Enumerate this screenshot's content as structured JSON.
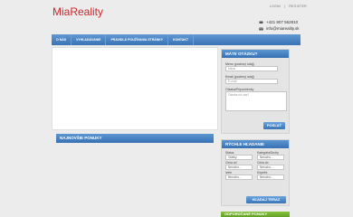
{
  "header": {
    "logo": "MiaReality",
    "links": [
      "LOGIN",
      "REGISTER"
    ],
    "phone": "+421 907 562810",
    "email": "info@miareality.sk"
  },
  "nav": {
    "items": [
      "O NÁS",
      "VYHĽADÁVANIE",
      "PRAVIDLÁ POUŽÍVANIA STRÁNKY",
      "KONTAKT"
    ]
  },
  "sections": {
    "latest_offers": "NAJNOVŠIE PONUKY"
  },
  "contact_form": {
    "title": "MÁTE OTÁZKU?",
    "name_label": "Meno (povinný údaj)",
    "name_placeholder": "Meno",
    "email_label": "Email (povinný údaj)",
    "email_placeholder": "E-mail",
    "question_label": "Otázka/Pripomienky",
    "question_placeholder": "Otázka na nás?",
    "send_label": "POSLAŤ"
  },
  "quick_search": {
    "title": "RÝCHLE HĽADANIE",
    "fields": [
      {
        "label": "Status",
        "value": "Všetky"
      },
      {
        "label": "Kategória/Druhy",
        "value": "Nerozho..."
      },
      {
        "label": "Cena od",
        "value": "Nerozho..."
      },
      {
        "label": "Cena do",
        "value": "Nerozho..."
      },
      {
        "label": "Izieb",
        "value": "Nerozho..."
      },
      {
        "label": "Kúpeľní",
        "value": "Nerozho..."
      }
    ],
    "search_label": "HĽADAJ TERAZ"
  },
  "bottom_box": {
    "title": "ODPORÚČANÉ PONUKY"
  },
  "colors": {
    "accent": "#3a73b5",
    "logo": "#c8282c",
    "green": "#62a024"
  }
}
